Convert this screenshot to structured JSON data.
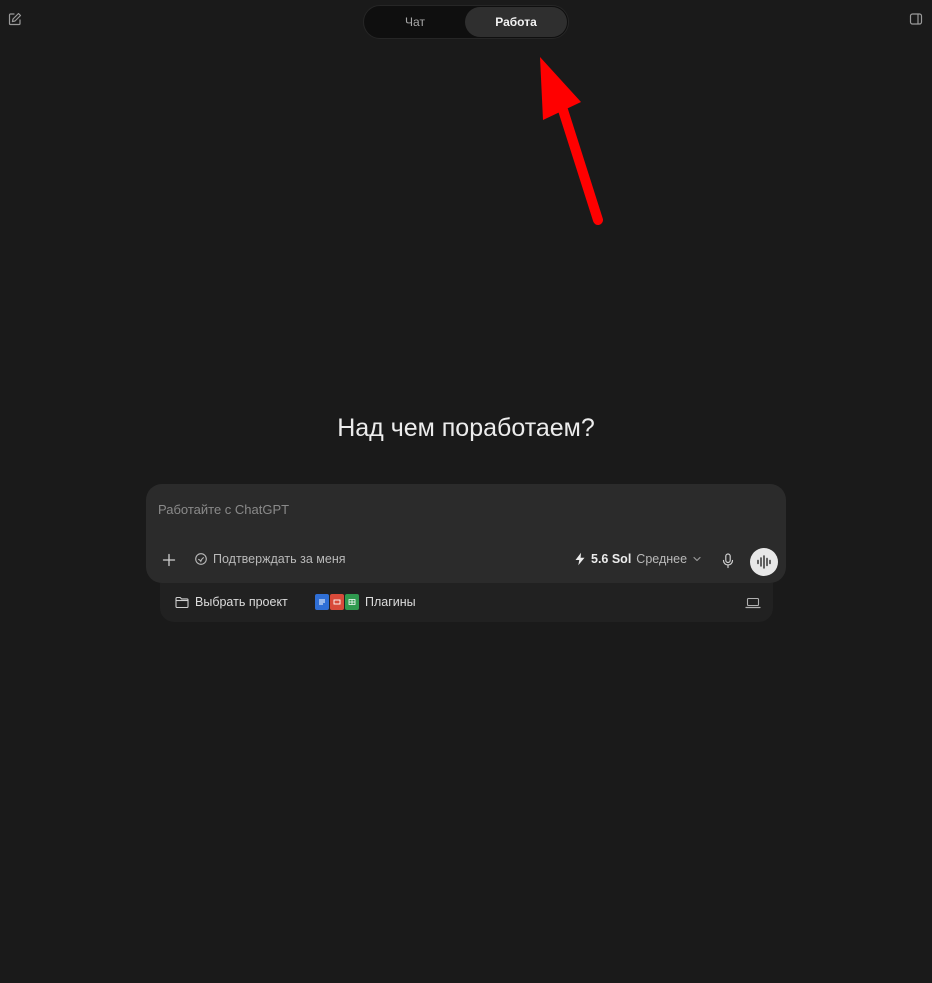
{
  "header": {
    "tabs": [
      {
        "label": "Чат",
        "active": false
      },
      {
        "label": "Работа",
        "active": true
      }
    ]
  },
  "main": {
    "headline": "Над чем поработаем?"
  },
  "composer": {
    "placeholder": "Работайте с ChatGPT",
    "confirm_label": "Подтверждать за меня",
    "model_name": "5.6 Sol",
    "model_level": "Среднее"
  },
  "subbar": {
    "project_label": "Выбрать проект",
    "plugins_label": "Плагины"
  },
  "icons": {
    "new_chat": "pencil-square-icon",
    "sidebar": "sidebar-toggle-icon",
    "add": "plus-icon",
    "confirm": "auto-confirm-icon",
    "model": "lightning-icon",
    "chevron": "chevron-down-icon",
    "mic": "microphone-icon",
    "voice": "voice-waveform-icon",
    "folder": "folder-icon",
    "laptop": "laptop-icon"
  },
  "colors": {
    "background": "#1a1a1a",
    "composer": "#2b2b2b",
    "annotation_arrow": "#ff0000"
  }
}
